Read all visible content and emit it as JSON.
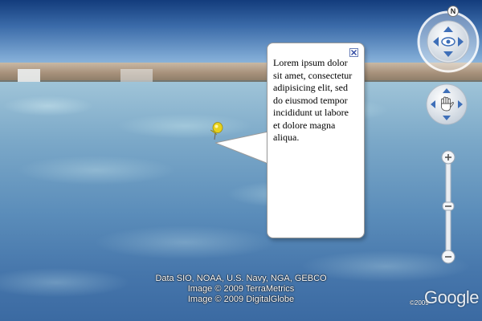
{
  "balloon": {
    "text": "Lorem ipsum dolor sit amet, consectetur adipisicing elit, sed do eiusmod tempor incididunt ut labore et dolore magna aliqua."
  },
  "controls": {
    "north_label": "N",
    "zoom_in": "+",
    "zoom_out": "−"
  },
  "attribution": {
    "line1": "Data SIO, NOAA, U.S. Navy, NGA, GEBCO",
    "line2": "Image © 2009 TerraMetrics",
    "line3": "Image © 2009 DigitalGlobe"
  },
  "logo": {
    "small": "©2009",
    "word": "Google"
  },
  "colors": {
    "pin": "#e8d21c",
    "water": "#4676ab",
    "sky": "#133c7c"
  },
  "icons": [
    "pushpin-icon",
    "close-icon",
    "eye-icon",
    "hand-icon",
    "arrow-up-icon",
    "arrow-down-icon",
    "arrow-left-icon",
    "arrow-right-icon"
  ]
}
